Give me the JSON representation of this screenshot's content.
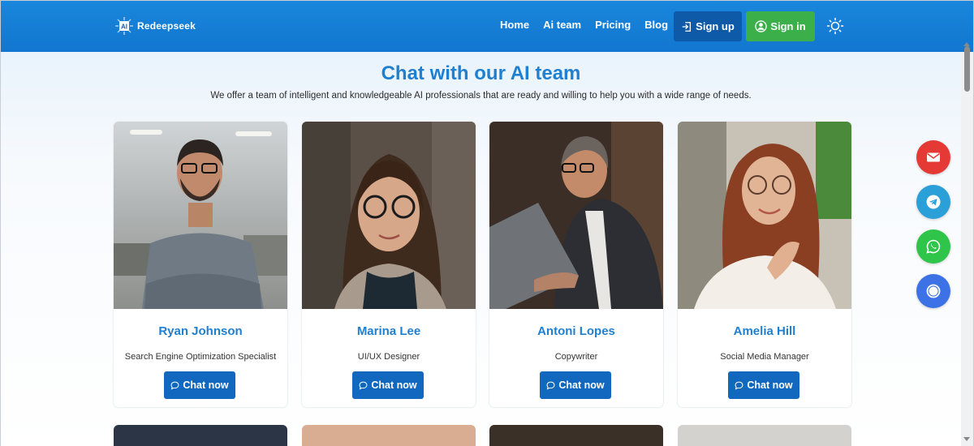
{
  "header": {
    "logo_text": "Redeepseek",
    "logo_badge": "AI",
    "nav": [
      "Home",
      "Ai team",
      "Pricing",
      "Blog"
    ],
    "signup_label": "Sign up",
    "signin_label": "Sign in"
  },
  "main": {
    "title": "Chat with our AI team",
    "subtitle": "We offer a team of intelligent and knowledgeable AI professionals that are ready and willing to help you with a wide range of needs.",
    "team": [
      {
        "name": "Ryan Johnson",
        "role": "Search Engine Optimization Specialist",
        "button": "Chat now"
      },
      {
        "name": "Marina Lee",
        "role": "UI/UX Designer",
        "button": "Chat now"
      },
      {
        "name": "Antoni Lopes",
        "role": "Copywriter",
        "button": "Chat now"
      },
      {
        "name": "Amelia Hill",
        "role": "Social Media Manager",
        "button": "Chat now"
      }
    ]
  },
  "floating_actions": [
    {
      "icon": "email-icon",
      "color": "#e53935"
    },
    {
      "icon": "telegram-icon",
      "color": "#2a9fd8"
    },
    {
      "icon": "whatsapp-icon",
      "color": "#2fc44a"
    },
    {
      "icon": "chat-bubble-icon",
      "color": "#3d72e6"
    }
  ],
  "colors": {
    "header": "#1a86dc",
    "accent": "#1f7fd0",
    "signup_bg": "#0e5aa8",
    "signin_bg": "#3bb04a",
    "chat_button": "#1168be"
  }
}
